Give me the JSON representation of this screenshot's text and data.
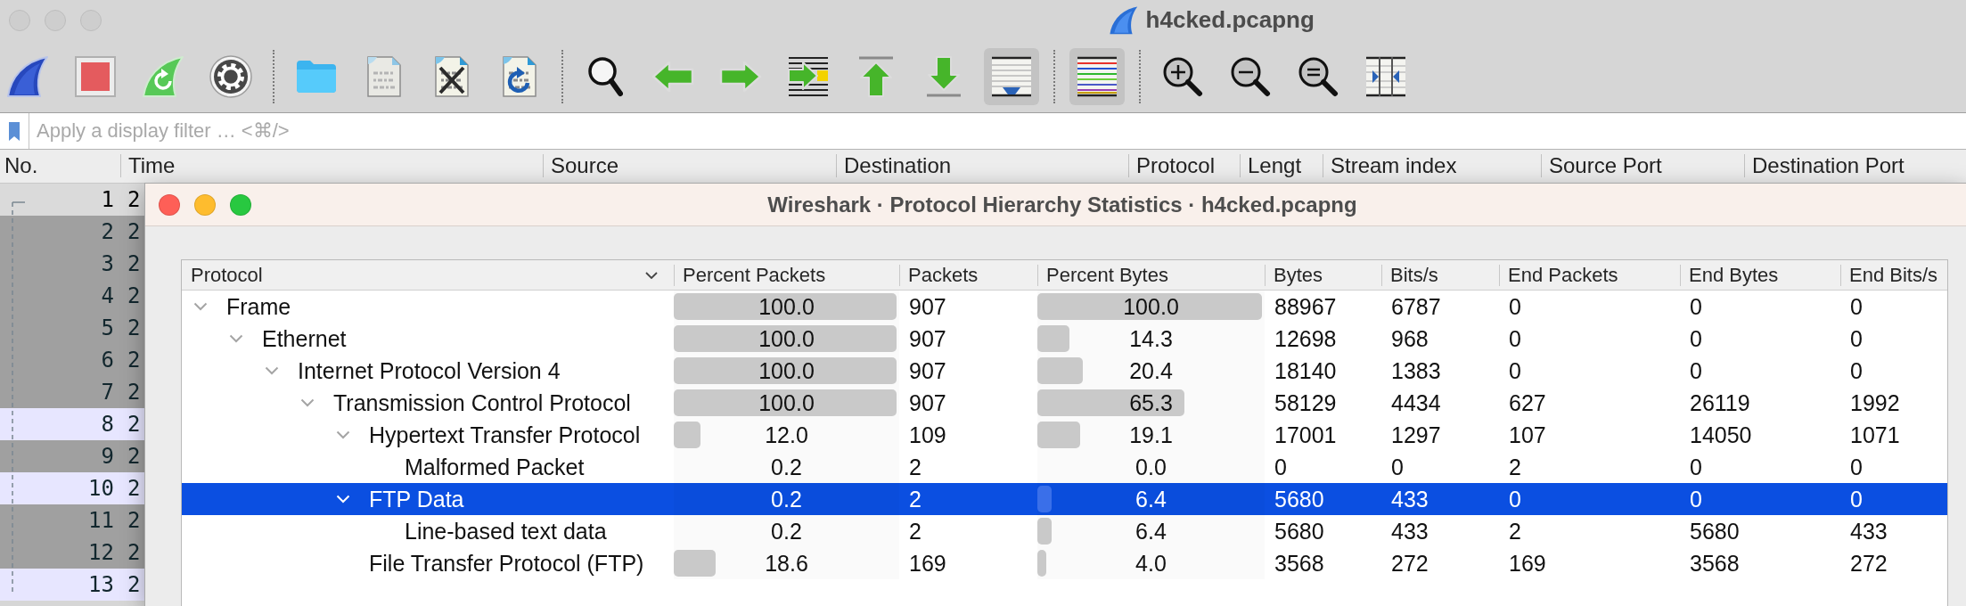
{
  "main_window": {
    "title": "h4cked.pcapng"
  },
  "toolbar": {
    "toggles": [
      {
        "checked": true
      },
      {
        "checked": true
      }
    ]
  },
  "filter_bar": {
    "placeholder": "Apply a display filter … <⌘/>"
  },
  "packet_list": {
    "columns": [
      "No.",
      "Time",
      "Source",
      "Destination",
      "Protocol",
      "Lengt",
      "Stream index",
      "Source Port",
      "Destination Port"
    ],
    "rows": [
      {
        "number": "1",
        "time": "2",
        "selected": true
      },
      {
        "number": "2",
        "time": "2",
        "selected": false,
        "color": "#a0a0a0"
      },
      {
        "number": "3",
        "time": "2",
        "selected": false,
        "color": "#a0a0a0"
      },
      {
        "number": "4",
        "time": "2",
        "selected": false,
        "color": "#a0a0a0"
      },
      {
        "number": "5",
        "time": "2",
        "selected": false,
        "color": "#a0a0a0"
      },
      {
        "number": "6",
        "time": "2",
        "selected": false,
        "color": "#a0a0a0"
      },
      {
        "number": "7",
        "time": "2",
        "selected": false,
        "color": "#a0a0a0"
      },
      {
        "number": "8",
        "time": "2",
        "selected": false,
        "color": "#e7e6ff"
      },
      {
        "number": "9",
        "time": "2",
        "selected": false,
        "color": "#a0a0a0"
      },
      {
        "number": "10",
        "time": "2",
        "selected": false,
        "color": "#e7e6ff"
      },
      {
        "number": "11",
        "time": "2",
        "selected": false,
        "color": "#a0a0a0"
      },
      {
        "number": "12",
        "time": "2",
        "selected": false,
        "color": "#a0a0a0"
      },
      {
        "number": "13",
        "time": "2",
        "selected": false,
        "color": "#e7e6ff"
      }
    ]
  },
  "dialog": {
    "title": "Wireshark · Protocol Hierarchy Statistics · h4cked.pcapng",
    "table": {
      "columns": [
        {
          "label": "Protocol",
          "sorted": true
        },
        {
          "label": "Percent Packets",
          "sorted": false
        },
        {
          "label": "Packets",
          "sorted": false
        },
        {
          "label": "Percent Bytes",
          "sorted": false
        },
        {
          "label": "Bytes",
          "sorted": false
        },
        {
          "label": "Bits/s",
          "sorted": false
        },
        {
          "label": "End Packets",
          "sorted": false
        },
        {
          "label": "End Bytes",
          "sorted": false
        },
        {
          "label": "End Bits/s",
          "sorted": false
        }
      ],
      "rows": [
        {
          "protocol": "Frame",
          "percent_packets": {
            "text": "100.0",
            "level": 1
          },
          "packets": "907",
          "percent_bytes": {
            "text": "100.0",
            "level": 1
          },
          "bytes": "88967",
          "bits_per_s": "6787",
          "end_packets": "0",
          "end_bytes": "0",
          "end_bits_per_s": "0",
          "selected": false,
          "expanded": true,
          "children": [
            {
              "protocol": "Ethernet",
              "percent_packets": {
                "text": "100.0",
                "level": 1
              },
              "packets": "907",
              "percent_bytes": {
                "text": "14.3",
                "level": 0.143
              },
              "bytes": "12698",
              "bits_per_s": "968",
              "end_packets": "0",
              "end_bytes": "0",
              "end_bits_per_s": "0",
              "selected": false,
              "expanded": true,
              "children": [
                {
                  "protocol": "Internet Protocol Version 4",
                  "percent_packets": {
                    "text": "100.0",
                    "level": 1
                  },
                  "packets": "907",
                  "percent_bytes": {
                    "text": "20.4",
                    "level": 0.204
                  },
                  "bytes": "18140",
                  "bits_per_s": "1383",
                  "end_packets": "0",
                  "end_bytes": "0",
                  "end_bits_per_s": "0",
                  "selected": false,
                  "expanded": true,
                  "children": [
                    {
                      "protocol": "Transmission Control Protocol",
                      "percent_packets": {
                        "text": "100.0",
                        "level": 1
                      },
                      "packets": "907",
                      "percent_bytes": {
                        "text": "65.3",
                        "level": 0.653
                      },
                      "bytes": "58129",
                      "bits_per_s": "4434",
                      "end_packets": "627",
                      "end_bytes": "26119",
                      "end_bits_per_s": "1992",
                      "selected": false,
                      "expanded": true,
                      "children": [
                        {
                          "protocol": "Hypertext Transfer Protocol",
                          "percent_packets": {
                            "text": "12.0",
                            "level": 0.12
                          },
                          "packets": "109",
                          "percent_bytes": {
                            "text": "19.1",
                            "level": 0.191
                          },
                          "bytes": "17001",
                          "bits_per_s": "1297",
                          "end_packets": "107",
                          "end_bytes": "14050",
                          "end_bits_per_s": "1071",
                          "selected": false,
                          "expanded": true,
                          "children": [
                            {
                              "protocol": "Malformed Packet",
                              "percent_packets": {
                                "text": "0.2"
                              },
                              "packets": "2",
                              "percent_bytes": {
                                "text": "0.0"
                              },
                              "bytes": "0",
                              "bits_per_s": "0",
                              "end_packets": "2",
                              "end_bytes": "0",
                              "end_bits_per_s": "0",
                              "selected": false
                            }
                          ]
                        },
                        {
                          "protocol": "FTP Data",
                          "percent_packets": {
                            "text": "0.2"
                          },
                          "packets": "2",
                          "percent_bytes": {
                            "text": "6.4",
                            "level": 0.064
                          },
                          "bytes": "5680",
                          "bits_per_s": "433",
                          "end_packets": "0",
                          "end_bytes": "0",
                          "end_bits_per_s": "0",
                          "selected": true,
                          "expanded": true,
                          "children": [
                            {
                              "protocol": "Line-based text data",
                              "percent_packets": {
                                "text": "0.2"
                              },
                              "packets": "2",
                              "percent_bytes": {
                                "text": "6.4",
                                "level": 0.064
                              },
                              "bytes": "5680",
                              "bits_per_s": "433",
                              "end_packets": "2",
                              "end_bytes": "5680",
                              "end_bits_per_s": "433",
                              "selected": false
                            }
                          ]
                        },
                        {
                          "protocol": "File Transfer Protocol (FTP)",
                          "percent_packets": {
                            "text": "18.6",
                            "level": 0.186
                          },
                          "packets": "169",
                          "percent_bytes": {
                            "text": "4.0",
                            "level": 0.04
                          },
                          "bytes": "3568",
                          "bits_per_s": "272",
                          "end_packets": "169",
                          "end_bytes": "3568",
                          "end_bits_per_s": "272",
                          "selected": false
                        }
                      ]
                    }
                  ]
                }
              ]
            }
          ]
        }
      ]
    }
  }
}
